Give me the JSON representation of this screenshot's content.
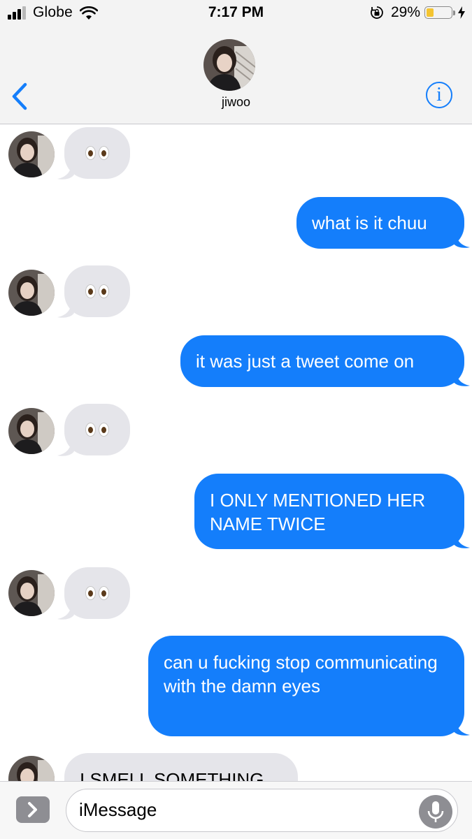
{
  "status_bar": {
    "carrier": "Globe",
    "time": "7:17 PM",
    "battery_percent": "29%",
    "battery_level": 0.29,
    "signal_bars": 3,
    "icons": [
      "signal-bars-icon",
      "wifi-icon",
      "rotation-lock-icon",
      "battery-icon",
      "charging-bolt-icon"
    ]
  },
  "header": {
    "contact_name": "jiwoo",
    "back_icon": "chevron-left-icon",
    "info_icon": "info-icon",
    "info_label": "i"
  },
  "messages": [
    {
      "direction": "incoming",
      "text": "",
      "emoji": "eyes"
    },
    {
      "direction": "outgoing",
      "text": "what is it chuu"
    },
    {
      "direction": "incoming",
      "text": "",
      "emoji": "eyes"
    },
    {
      "direction": "outgoing",
      "text": "it was just a tweet come on"
    },
    {
      "direction": "incoming",
      "text": "",
      "emoji": "eyes"
    },
    {
      "direction": "outgoing",
      "text": "I ONLY MENTIONED HER NAME TWICE"
    },
    {
      "direction": "incoming",
      "text": "",
      "emoji": "eyes"
    },
    {
      "direction": "outgoing",
      "text": "can u fucking stop communicating with the damn eyes"
    },
    {
      "direction": "incoming",
      "text": "I SMELL SOMETHING"
    }
  ],
  "input_bar": {
    "placeholder": "iMessage",
    "apps_icon": "chevron-right-icon",
    "mic_icon": "microphone-icon"
  },
  "colors": {
    "accent": "#147efb",
    "incoming_bubble": "#e5e5ea",
    "bar_background": "#f3f3f3",
    "battery": "#f4c431"
  }
}
